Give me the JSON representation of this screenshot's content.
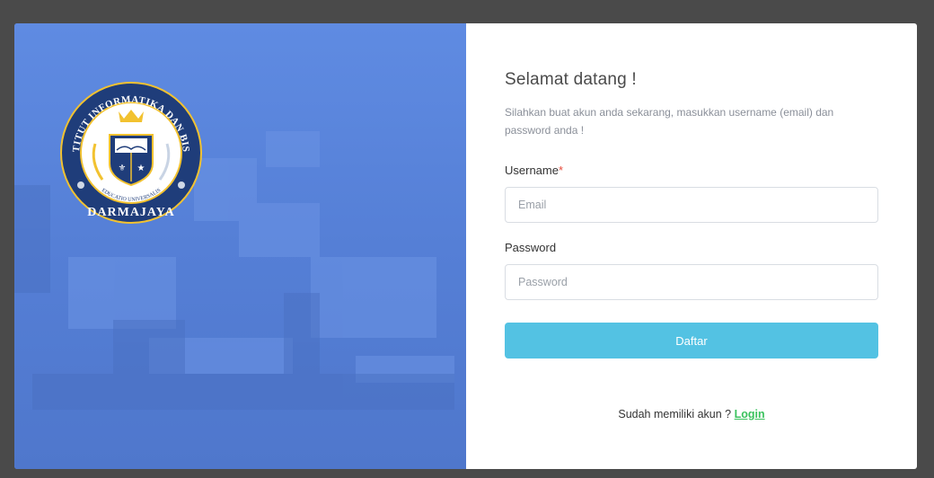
{
  "logo": {
    "arc_text_top": "INSTITUT INFORMATIKA DAN BISNIS",
    "motto": "EDUCATIO UNIVERSALIS",
    "name": "DARMAJAYA"
  },
  "form": {
    "title": "Selamat datang !",
    "subtitle": "Silahkan buat akun anda sekarang, masukkan username (email) dan password anda !",
    "username_label": "Username",
    "required_mark": "*",
    "email_placeholder": "Email",
    "password_label": "Password",
    "password_placeholder": "Password",
    "submit_label": "Daftar",
    "have_account_text": "Sudah memiliki akun ?",
    "login_link": "Login"
  },
  "colors": {
    "left_panel": "#5b86de",
    "button": "#53c2e3",
    "link": "#3bc25e",
    "logo_navy": "#1f3d7a",
    "logo_gold": "#f2c230"
  }
}
